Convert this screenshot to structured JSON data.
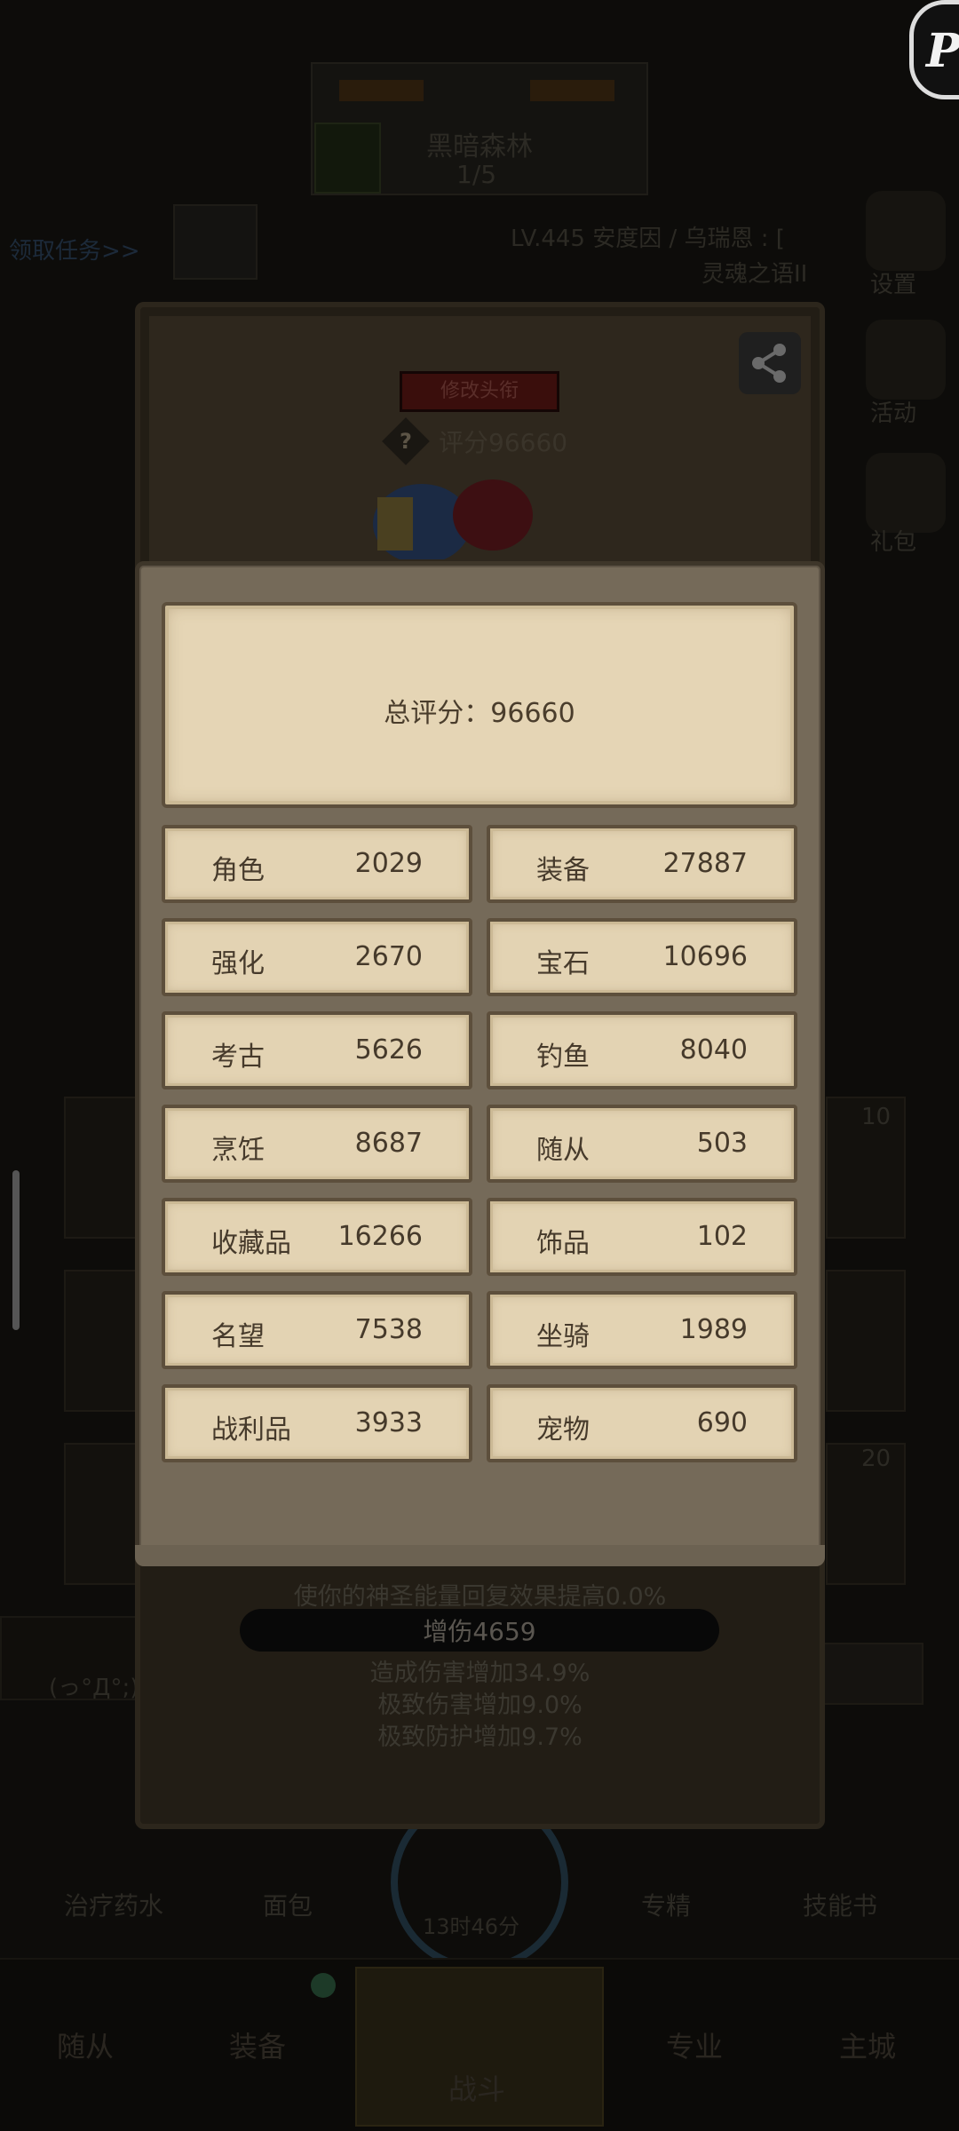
{
  "background": {
    "region_name": "黑暗森林",
    "region_page": "1/5",
    "quest_link": "领取任务>>",
    "player_line": "LV.445 安度因 / 乌瑞恩 : [",
    "guild_line": "灵魂之语II",
    "side_menu": [
      "设置",
      "活动",
      "礼包"
    ],
    "card_counts": [
      "10",
      "20"
    ],
    "items": [
      "治疗药水",
      "面包",
      "13时46分",
      "专精",
      "技能书"
    ],
    "nav": [
      "随从",
      "装备",
      "战斗",
      "专业",
      "主城"
    ],
    "left_strip_text": "(っ°Д°;)"
  },
  "player_panel": {
    "title_button": "修改头衔",
    "help_icon": "?",
    "score_label": "评分96660",
    "effects": [
      "使你的神圣能量回复效果提高0.0%",
      "增伤4659",
      "造成伤害增加34.9%",
      "极致伤害增加9.0%",
      "极致防护增加9.7%"
    ]
  },
  "score_popup": {
    "total_label": "总评分：96660",
    "items": [
      {
        "label": "角色",
        "value": "2029"
      },
      {
        "label": "装备",
        "value": "27887"
      },
      {
        "label": "强化",
        "value": "2670"
      },
      {
        "label": "宝石",
        "value": "10696"
      },
      {
        "label": "考古",
        "value": "5626"
      },
      {
        "label": "钓鱼",
        "value": "8040"
      },
      {
        "label": "烹饪",
        "value": "8687"
      },
      {
        "label": "随从",
        "value": "503"
      },
      {
        "label": "收藏品",
        "value": "16266"
      },
      {
        "label": "饰品",
        "value": "102"
      },
      {
        "label": "名望",
        "value": "7538"
      },
      {
        "label": "坐骑",
        "value": "1989"
      },
      {
        "label": "战利品",
        "value": "3933"
      },
      {
        "label": "宠物",
        "value": "690"
      }
    ]
  },
  "corner_badge": "P"
}
